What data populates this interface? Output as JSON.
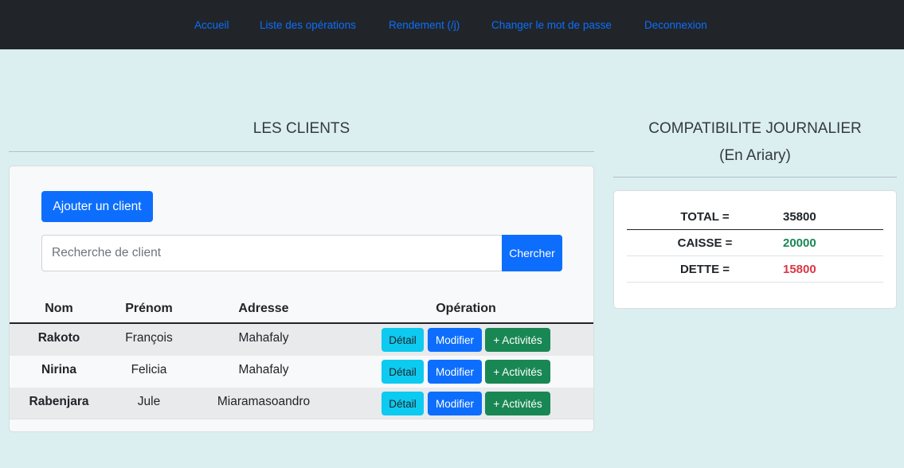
{
  "nav": {
    "items": [
      {
        "label": "Accueil"
      },
      {
        "label": "Liste des opérations"
      },
      {
        "label": "Rendement (/j)"
      },
      {
        "label": "Changer le mot de passe"
      },
      {
        "label": "Deconnexion"
      }
    ]
  },
  "clients": {
    "title": "LES CLIENTS",
    "add_button": "Ajouter un client",
    "search_placeholder": "Recherche de client",
    "search_button": "Chercher",
    "columns": [
      "Nom",
      "Prénom",
      "Adresse",
      "Opération"
    ],
    "action_labels": {
      "detail": "Détail",
      "modify": "Modifier",
      "activities": "+ Activités"
    },
    "rows": [
      {
        "nom": "Rakoto",
        "prenom": "François",
        "adresse": "Mahafaly"
      },
      {
        "nom": "Nirina",
        "prenom": "Felicia",
        "adresse": "Mahafaly"
      },
      {
        "nom": "Rabenjara",
        "prenom": "Jule",
        "adresse": "Miaramasoandro"
      }
    ]
  },
  "compta": {
    "title": "COMPATIBILITE JOURNALIER",
    "subtitle": "(En Ariary)",
    "rows": [
      {
        "label": "TOTAL =",
        "value": "35800",
        "color": "#212529"
      },
      {
        "label": "CAISSE =",
        "value": "20000",
        "color": "#198754"
      },
      {
        "label": "DETTE =",
        "value": "15800",
        "color": "#dc3545"
      }
    ]
  }
}
